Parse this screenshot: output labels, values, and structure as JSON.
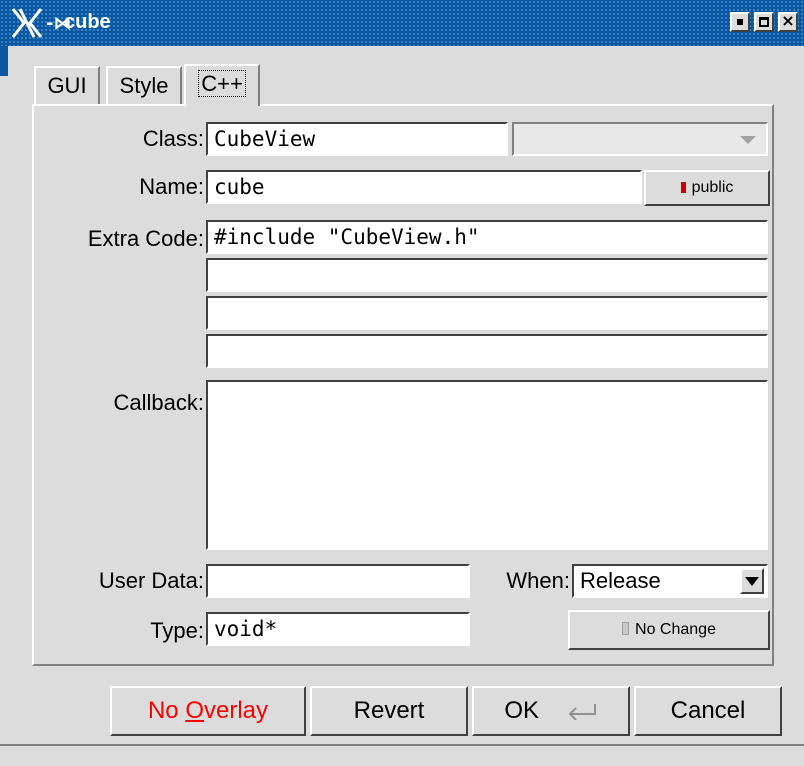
{
  "window": {
    "title": "cube"
  },
  "tabs": [
    "GUI",
    "Style",
    "C++"
  ],
  "active_tab": "C++",
  "form": {
    "class_label": "Class:",
    "class_value": "CubeView",
    "name_label": "Name:",
    "name_value": "cube",
    "public_label": "public",
    "extra_code_label": "Extra Code:",
    "extra_code": [
      "#include \"CubeView.h\"",
      "",
      "",
      ""
    ],
    "callback_label": "Callback:",
    "callback_value": "",
    "user_data_label": "User Data:",
    "user_data_value": "",
    "when_label": "When:",
    "when_value": "Release",
    "type_label": "Type:",
    "type_value": "void*",
    "no_change_label": "No Change"
  },
  "buttons": {
    "no_overlay_prefix": "No ",
    "no_overlay_mnemonic": "O",
    "no_overlay_suffix": "verlay",
    "revert": "Revert",
    "ok": "OK",
    "cancel": "Cancel"
  },
  "colors": {
    "titlebar": "#0a57a0",
    "no_overlay_text": "#ff0000",
    "public_indicator": "#cc0000",
    "no_change_indicator": "#c8c8c8"
  }
}
